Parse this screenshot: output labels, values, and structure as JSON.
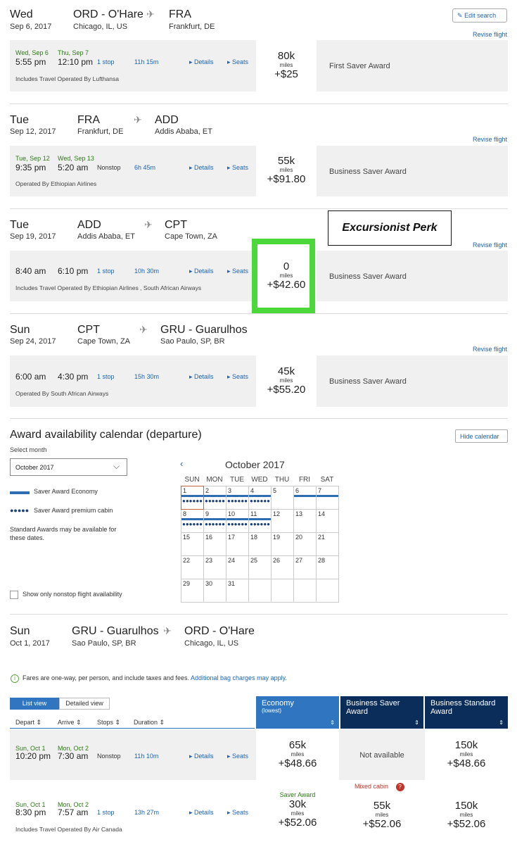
{
  "header": {
    "edit_search": "Edit search",
    "revise": "Revise flight"
  },
  "segments": [
    {
      "day": "Wed",
      "date": "Sep 6, 2017",
      "from_code": "ORD - O'Hare",
      "from_city": "Chicago, IL, US",
      "to_code": "FRA",
      "to_city": "Frankfurt, DE",
      "dep_date": "Wed, Sep 6",
      "dep_time": "5:55 pm",
      "arr_date": "Thu, Sep 7",
      "arr_time": "12:10 pm",
      "stops": "1 stop",
      "duration": "11h 15m",
      "details": "Details",
      "seats": "Seats",
      "operated": "Includes Travel Operated By Lufthansa",
      "miles": "80k",
      "miles_word": "miles",
      "fee": "+$25",
      "award": "First Saver Award"
    },
    {
      "day": "Tue",
      "date": "Sep 12, 2017",
      "from_code": "FRA",
      "from_city": "Frankfurt, DE",
      "to_code": "ADD",
      "to_city": "Addis Ababa, ET",
      "dep_date": "Tue, Sep 12",
      "dep_time": "9:35 pm",
      "arr_date": "Wed, Sep 13",
      "arr_time": "5:20 am",
      "stops": "Nonstop",
      "duration": "6h 45m",
      "details": "Details",
      "seats": "Seats",
      "operated": "Operated By Ethiopian Airlines",
      "miles": "55k",
      "miles_word": "miles",
      "fee": "+$91.80",
      "award": "Business Saver Award"
    },
    {
      "day": "Tue",
      "date": "Sep 19, 2017",
      "from_code": "ADD",
      "from_city": "Addis Ababa, ET",
      "to_code": "CPT",
      "to_city": "Cape Town, ZA",
      "dep_date": "",
      "dep_time": "8:40 am",
      "arr_date": "",
      "arr_time": "6:10 pm",
      "stops": "1 stop",
      "duration": "10h 30m",
      "details": "Details",
      "seats": "Seats",
      "operated": "Includes Travel Operated By Ethiopian Airlines , South African Airways",
      "miles": "0",
      "miles_word": "miles",
      "fee": "+$42.60",
      "award": "Business Saver Award"
    },
    {
      "day": "Sun",
      "date": "Sep 24, 2017",
      "from_code": "CPT",
      "from_city": "Cape Town, ZA",
      "to_code": "GRU - Guarulhos",
      "to_city": "Sao Paulo, SP, BR",
      "dep_date": "",
      "dep_time": "6:00 am",
      "arr_date": "",
      "arr_time": "4:30 pm",
      "stops": "1 stop",
      "duration": "15h 30m",
      "details": "Details",
      "seats": "Seats",
      "operated": "Operated By South African Airways",
      "miles": "45k",
      "miles_word": "miles",
      "fee": "+$55.20",
      "award": "Business Saver Award"
    }
  ],
  "perk_label": "Excursionist Perk",
  "calendar": {
    "title": "Award availability calendar (departure)",
    "hide": "Hide calendar",
    "select_month_label": "Select month",
    "month_value": "October 2017",
    "month_title": "October 2017",
    "legend_economy": "Saver Award Economy",
    "legend_premium": "Saver Award premium cabin",
    "legend_note": "Standard Awards may be available for these dates.",
    "nonstop_label": "Show only nonstop flight availability",
    "weekdays": [
      "SUN",
      "MON",
      "TUE",
      "WED",
      "THU",
      "FRI",
      "SAT"
    ],
    "days": [
      "1",
      "2",
      "3",
      "4",
      "5",
      "6",
      "7",
      "8",
      "9",
      "10",
      "11",
      "12",
      "13",
      "14",
      "15",
      "16",
      "17",
      "18",
      "19",
      "20",
      "21",
      "22",
      "23",
      "24",
      "25",
      "26",
      "27",
      "28",
      "29",
      "30",
      "31"
    ]
  },
  "return": {
    "day": "Sun",
    "date": "Oct 1, 2017",
    "from_code": "GRU - Guarulhos",
    "from_city": "Sao Paulo, SP, BR",
    "to_code": "ORD - O'Hare",
    "to_city": "Chicago, IL, US",
    "info_text": "Fares are one-way, per person, and include taxes and fees.",
    "info_link": "Additional bag charges may apply.",
    "list_view": "List view",
    "detailed_view": "Detailed view",
    "sort_depart": "Depart",
    "sort_arrive": "Arrive",
    "sort_stops": "Stops",
    "sort_duration": "Duration",
    "col_economy": "Economy",
    "col_economy_sub": "(lowest)",
    "col_bsaver": "Business Saver Award",
    "col_bstandard": "Business Standard Award",
    "flights": [
      {
        "dep_date": "Sun, Oct 1",
        "dep_time": "10:20 pm",
        "arr_date": "Mon, Oct 2",
        "arr_time": "7:30 am",
        "stops": "Nonstop",
        "duration": "11h 10m",
        "details": "Details",
        "seats": "Seats",
        "operated": "",
        "eco_miles": "65k",
        "eco_fee": "+$48.66",
        "bsaver": "Not available",
        "bstd_miles": "150k",
        "bstd_fee": "+$48.66",
        "eco_tag": "",
        "mixed": ""
      },
      {
        "dep_date": "Sun, Oct 1",
        "dep_time": "8:30 pm",
        "arr_date": "Mon, Oct 2",
        "arr_time": "7:57 am",
        "stops": "1 stop",
        "duration": "13h 27m",
        "details": "Details",
        "seats": "Seats",
        "operated": "Includes Travel Operated By Air Canada",
        "eco_miles": "30k",
        "eco_fee": "+$52.06",
        "bsaver_miles": "55k",
        "bsaver_fee": "+$52.06",
        "bstd_miles": "150k",
        "bstd_fee": "+$52.06",
        "eco_tag": "Saver Award",
        "mixed": "Mixed cabin"
      }
    ],
    "miles_word": "miles"
  },
  "colors": {
    "accent": "#1b64b8",
    "economy_header": "#2f75c0",
    "business_header": "#0b2d59",
    "highlight": "#4cd83a"
  }
}
